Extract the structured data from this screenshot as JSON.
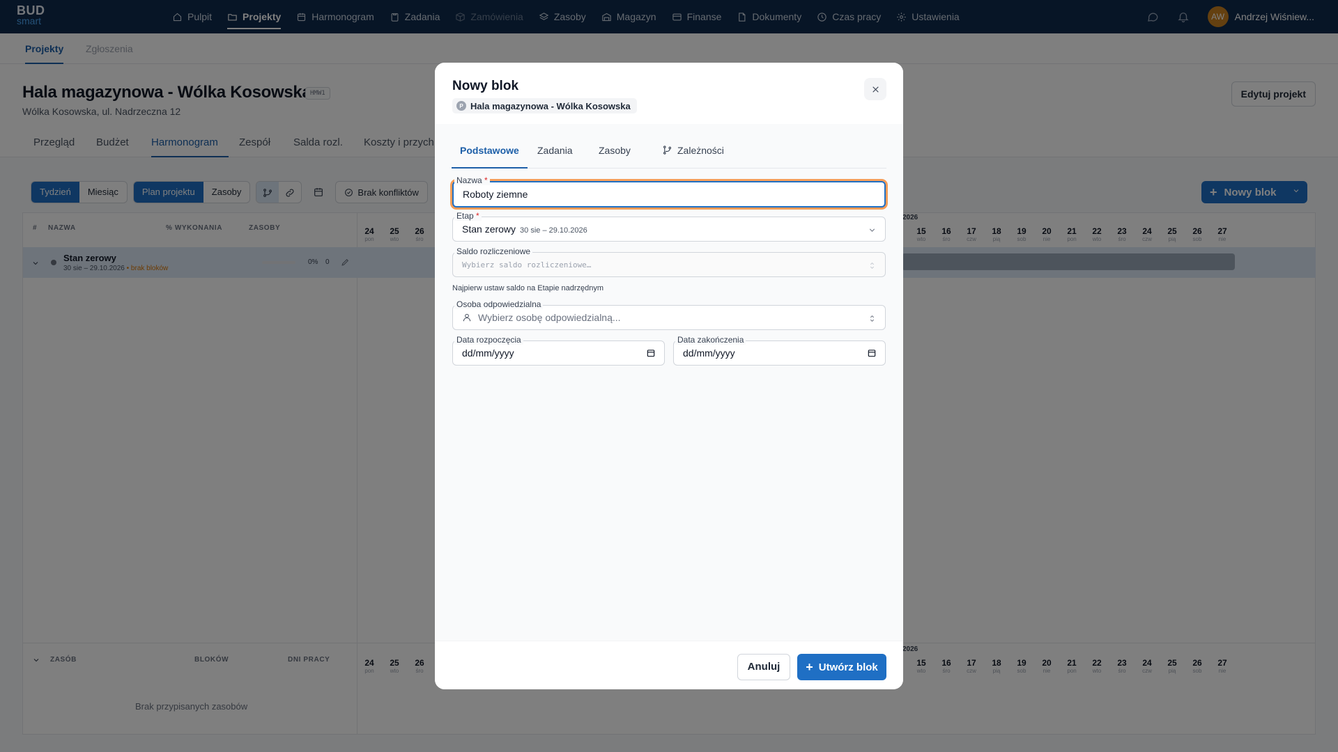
{
  "brand": {
    "line1": "BUD",
    "line2": "smart"
  },
  "nav": {
    "items": [
      {
        "label": "Pulpit",
        "icon": "home-icon"
      },
      {
        "label": "Projekty",
        "icon": "folder-icon"
      },
      {
        "label": "Harmonogram",
        "icon": "calendar-icon"
      },
      {
        "label": "Zadania",
        "icon": "clipboard-icon"
      },
      {
        "label": "Zamówienia",
        "icon": "box-icon"
      },
      {
        "label": "Zasoby",
        "icon": "layers-icon"
      },
      {
        "label": "Magazyn",
        "icon": "warehouse-icon"
      },
      {
        "label": "Finanse",
        "icon": "card-icon"
      },
      {
        "label": "Dokumenty",
        "icon": "document-icon"
      },
      {
        "label": "Czas pracy",
        "icon": "clock-icon"
      },
      {
        "label": "Ustawienia",
        "icon": "gear-icon"
      }
    ],
    "active": "Projekty",
    "disabled": "Zamówienia",
    "user": {
      "initials": "AW",
      "name": "Andrzej Wiśniew..."
    }
  },
  "subtabs": [
    "Projekty",
    "Zgłoszenia"
  ],
  "project": {
    "title": "Hala magazynowa - Wólka Kosowska",
    "code": "HMW1",
    "address": "Wólka Kosowska, ul. Nadrzeczna 12",
    "edit_label": "Edytuj projekt",
    "tabs": [
      "Przegląd",
      "Budżet",
      "Harmonogram",
      "Zespół",
      "Salda rozl.",
      "Koszty i przych"
    ]
  },
  "toolbar": {
    "range": [
      "Tydzień",
      "Miesiąc"
    ],
    "view": [
      "Plan projektu",
      "Zasoby"
    ],
    "conflicts": "Brak konfliktów",
    "new_block": "Nowy blok"
  },
  "table": {
    "headers": [
      "#",
      "NAZWA",
      "% WYKONANIA",
      "ZASOBY"
    ],
    "rows": [
      {
        "name": "Stan zerowy",
        "dates": "30 sie – 29.10.2026",
        "warning": "brak bloków",
        "progress": "0%",
        "resources": "0"
      }
    ],
    "resource_headers": [
      "ZASÓB",
      "BLOKÓW",
      "DNI PRACY"
    ],
    "no_resources": "Brak przypisanych zasobów"
  },
  "timeline": {
    "year": "2026",
    "days_left": [
      {
        "n": "24",
        "w": "pon"
      },
      {
        "n": "25",
        "w": "wto"
      },
      {
        "n": "26",
        "w": "śro"
      }
    ],
    "days_right": [
      {
        "n": "15",
        "w": "wto"
      },
      {
        "n": "16",
        "w": "śro"
      },
      {
        "n": "17",
        "w": "czw"
      },
      {
        "n": "18",
        "w": "pią"
      },
      {
        "n": "19",
        "w": "sob"
      },
      {
        "n": "20",
        "w": "nie"
      },
      {
        "n": "21",
        "w": "pon"
      },
      {
        "n": "22",
        "w": "wto"
      },
      {
        "n": "23",
        "w": "śro"
      },
      {
        "n": "24",
        "w": "czw"
      },
      {
        "n": "25",
        "w": "pią"
      },
      {
        "n": "26",
        "w": "sob"
      },
      {
        "n": "27",
        "w": "nie"
      }
    ]
  },
  "modal": {
    "title": "Nowy blok",
    "project_chip": "Hala magazynowa - Wólka Kosowska",
    "chip_initial": "P",
    "tabs": [
      "Podstawowe",
      "Zadania",
      "Zasoby",
      "Zależności"
    ],
    "fields": {
      "name": {
        "label": "Nazwa",
        "value": "Roboty ziemne"
      },
      "stage": {
        "label": "Etap",
        "value": "Stan zerowy",
        "sub": "30 sie – 29.10.2026"
      },
      "balance": {
        "label": "Saldo rozliczeniowe",
        "placeholder": "Wybierz saldo rozliczeniowe…",
        "hint": "Najpierw ustaw saldo na Etapie nadrzędnym"
      },
      "person": {
        "label": "Osoba odpowiedzialna",
        "placeholder": "Wybierz osobę odpowiedzialną..."
      },
      "start": {
        "label": "Data rozpoczęcia",
        "value": "dd/mm/yyyy"
      },
      "end": {
        "label": "Data zakończenia",
        "value": "dd/mm/yyyy"
      }
    },
    "cancel": "Anuluj",
    "submit": "Utwórz blok",
    "required_mark": "*"
  }
}
